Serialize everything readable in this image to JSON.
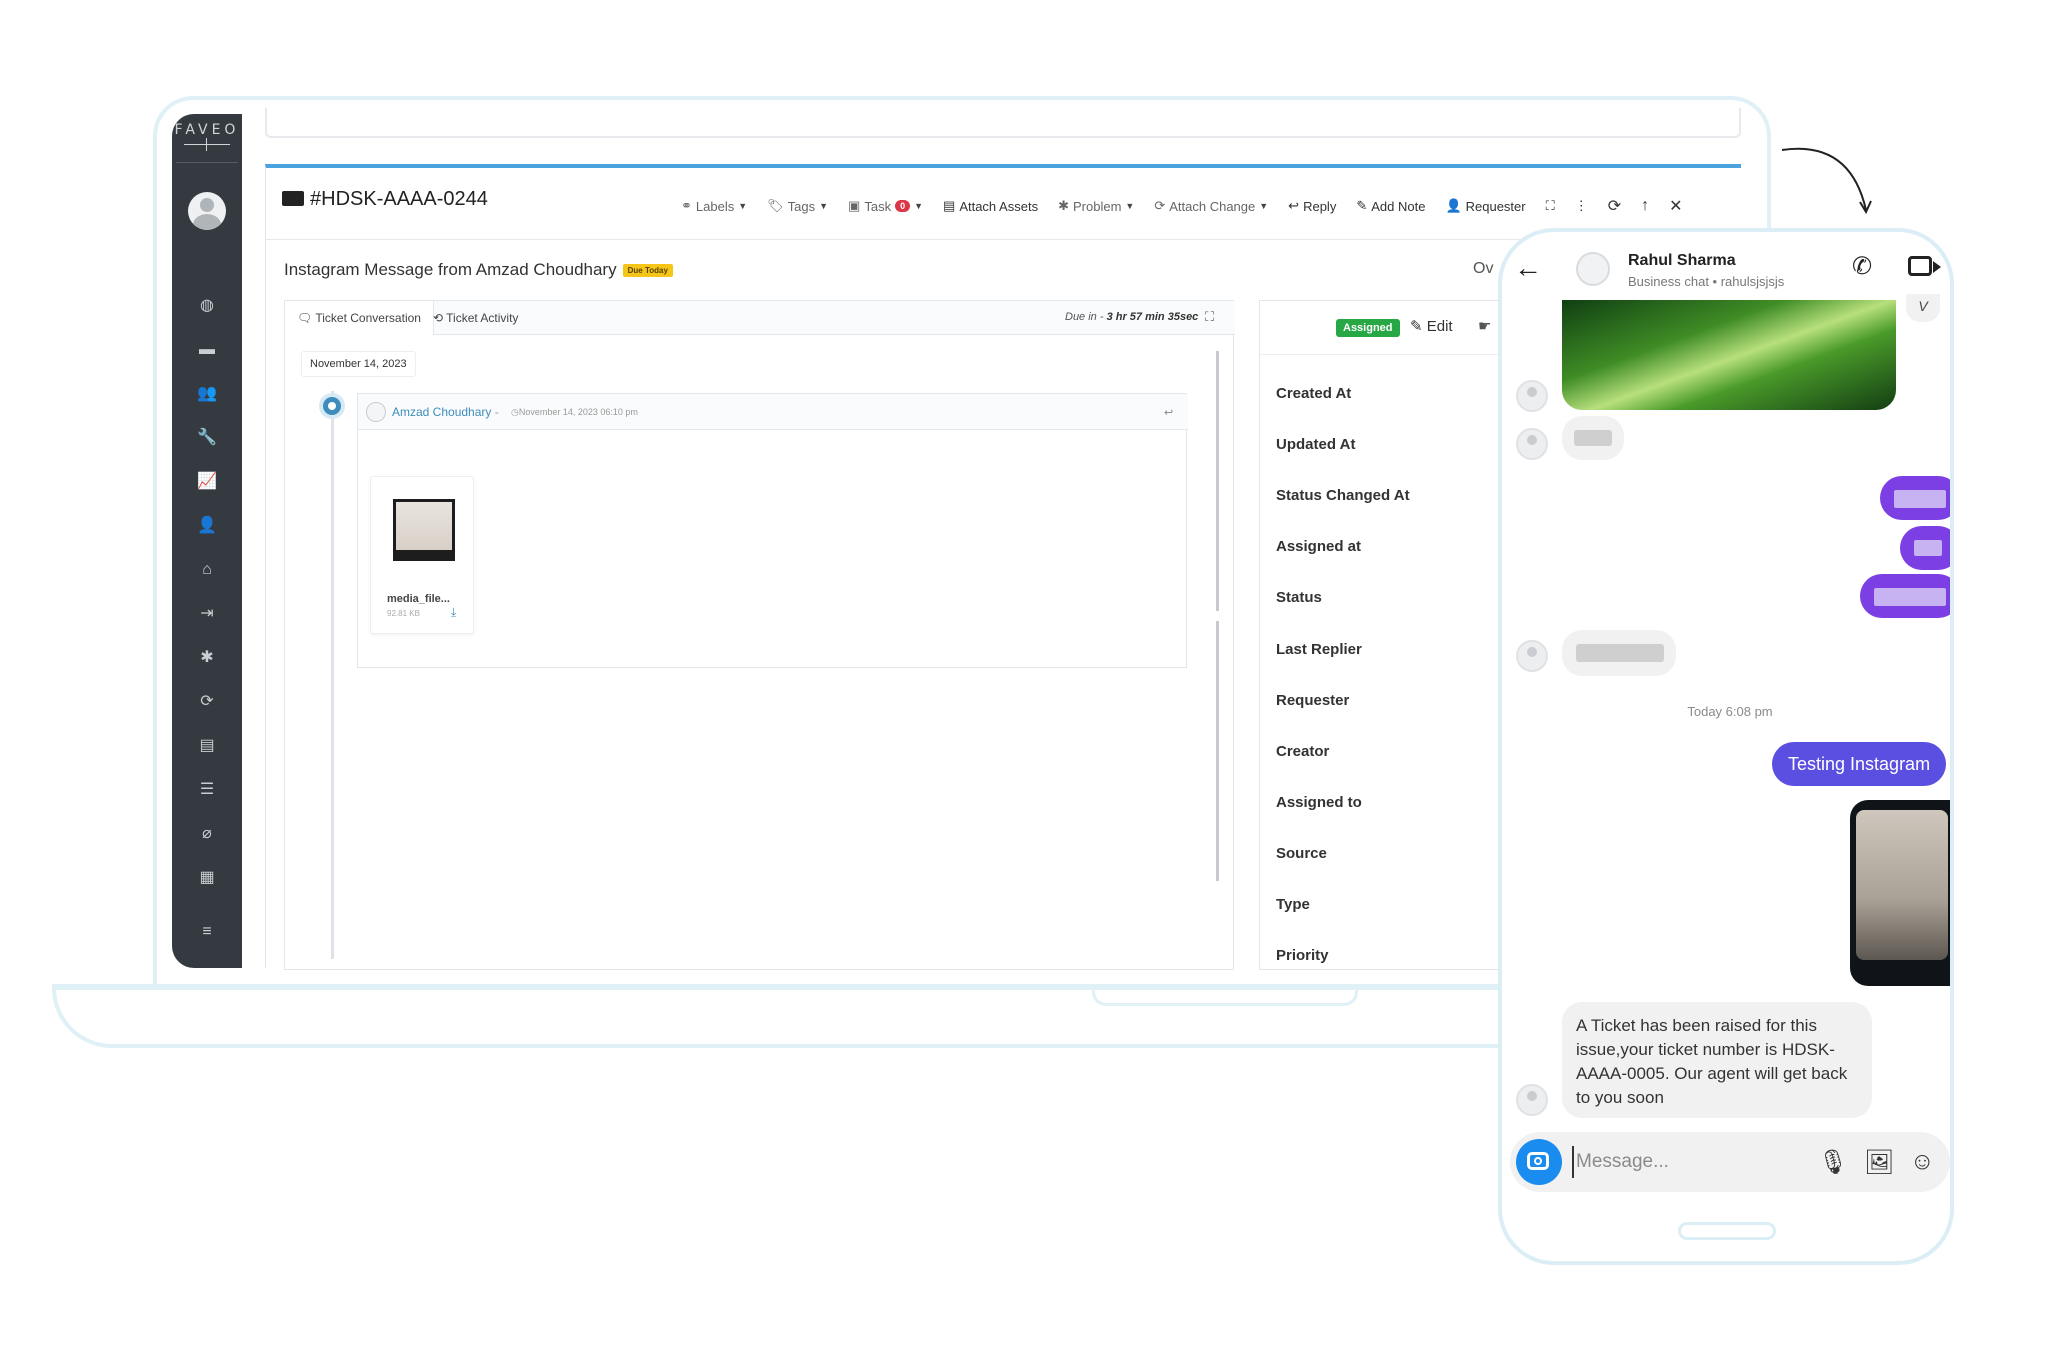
{
  "sidebar": {
    "logo": "FAVEO",
    "icons": [
      "dashboard-icon",
      "tickets-icon",
      "users-icon",
      "tools-icon",
      "reports-icon",
      "user-settings-icon",
      "home-icon",
      "logout-icon",
      "bug-icon",
      "sync-icon",
      "news-icon",
      "server-icon",
      "attachment-icon",
      "clipboard-icon",
      "list-icon"
    ]
  },
  "ticket": {
    "id": "#HDSK-AAAA-0244",
    "subject": "Instagram Message from Amzad Choudhary",
    "due_badge": "Due Today",
    "overflow_text": "Ov"
  },
  "toolbar": {
    "labels": "Labels",
    "tags": "Tags",
    "task": "Task",
    "task_count": "0",
    "attach_assets": "Attach Assets",
    "problem": "Problem",
    "attach_change": "Attach Change",
    "reply": "Reply",
    "add_note": "Add Note",
    "requester": "Requester"
  },
  "conversation": {
    "tabs": [
      "Ticket Conversation",
      "Ticket Activity"
    ],
    "due_in_label": "Due in - ",
    "due_in_value": "3 hr 57 min 35sec",
    "date": "November 14, 2023",
    "message": {
      "author": "Amzad Choudhary",
      "separator": " - ",
      "time": "November 14, 2023 06:10 pm",
      "attachment_name": "media_file...",
      "attachment_size": "92.81 KB"
    }
  },
  "details": {
    "status_badge": "Assigned",
    "edit_label": "Edit",
    "rows": [
      "Created At",
      "Updated At",
      "Status Changed At",
      "Assigned at",
      "Status",
      "Last Replier",
      "Requester",
      "Creator",
      "Assigned to",
      "Source",
      "Type",
      "Priority"
    ]
  },
  "phone": {
    "contact_name": "Rahul Sharma",
    "contact_sub": "Business chat • rahulsjsjsjs",
    "v_chip": "V",
    "timestamp": "Today 6:08 pm",
    "sent_message": "Testing Instagram",
    "bot_message": "A Ticket has been raised for this issue,your ticket number is HDSK-AAAA-0005. Our agent will get back to you soon",
    "input_placeholder": "Message..."
  },
  "colors": {
    "sidebar_bg": "#343a40",
    "accent_blue": "#3c8dbc",
    "assigned_green": "#28a745",
    "due_yellow": "#f5c518",
    "instagram_purple": "#7b3fe4",
    "sent_bubble": "#5a4fe0",
    "camera_blue": "#1a8cf0"
  }
}
